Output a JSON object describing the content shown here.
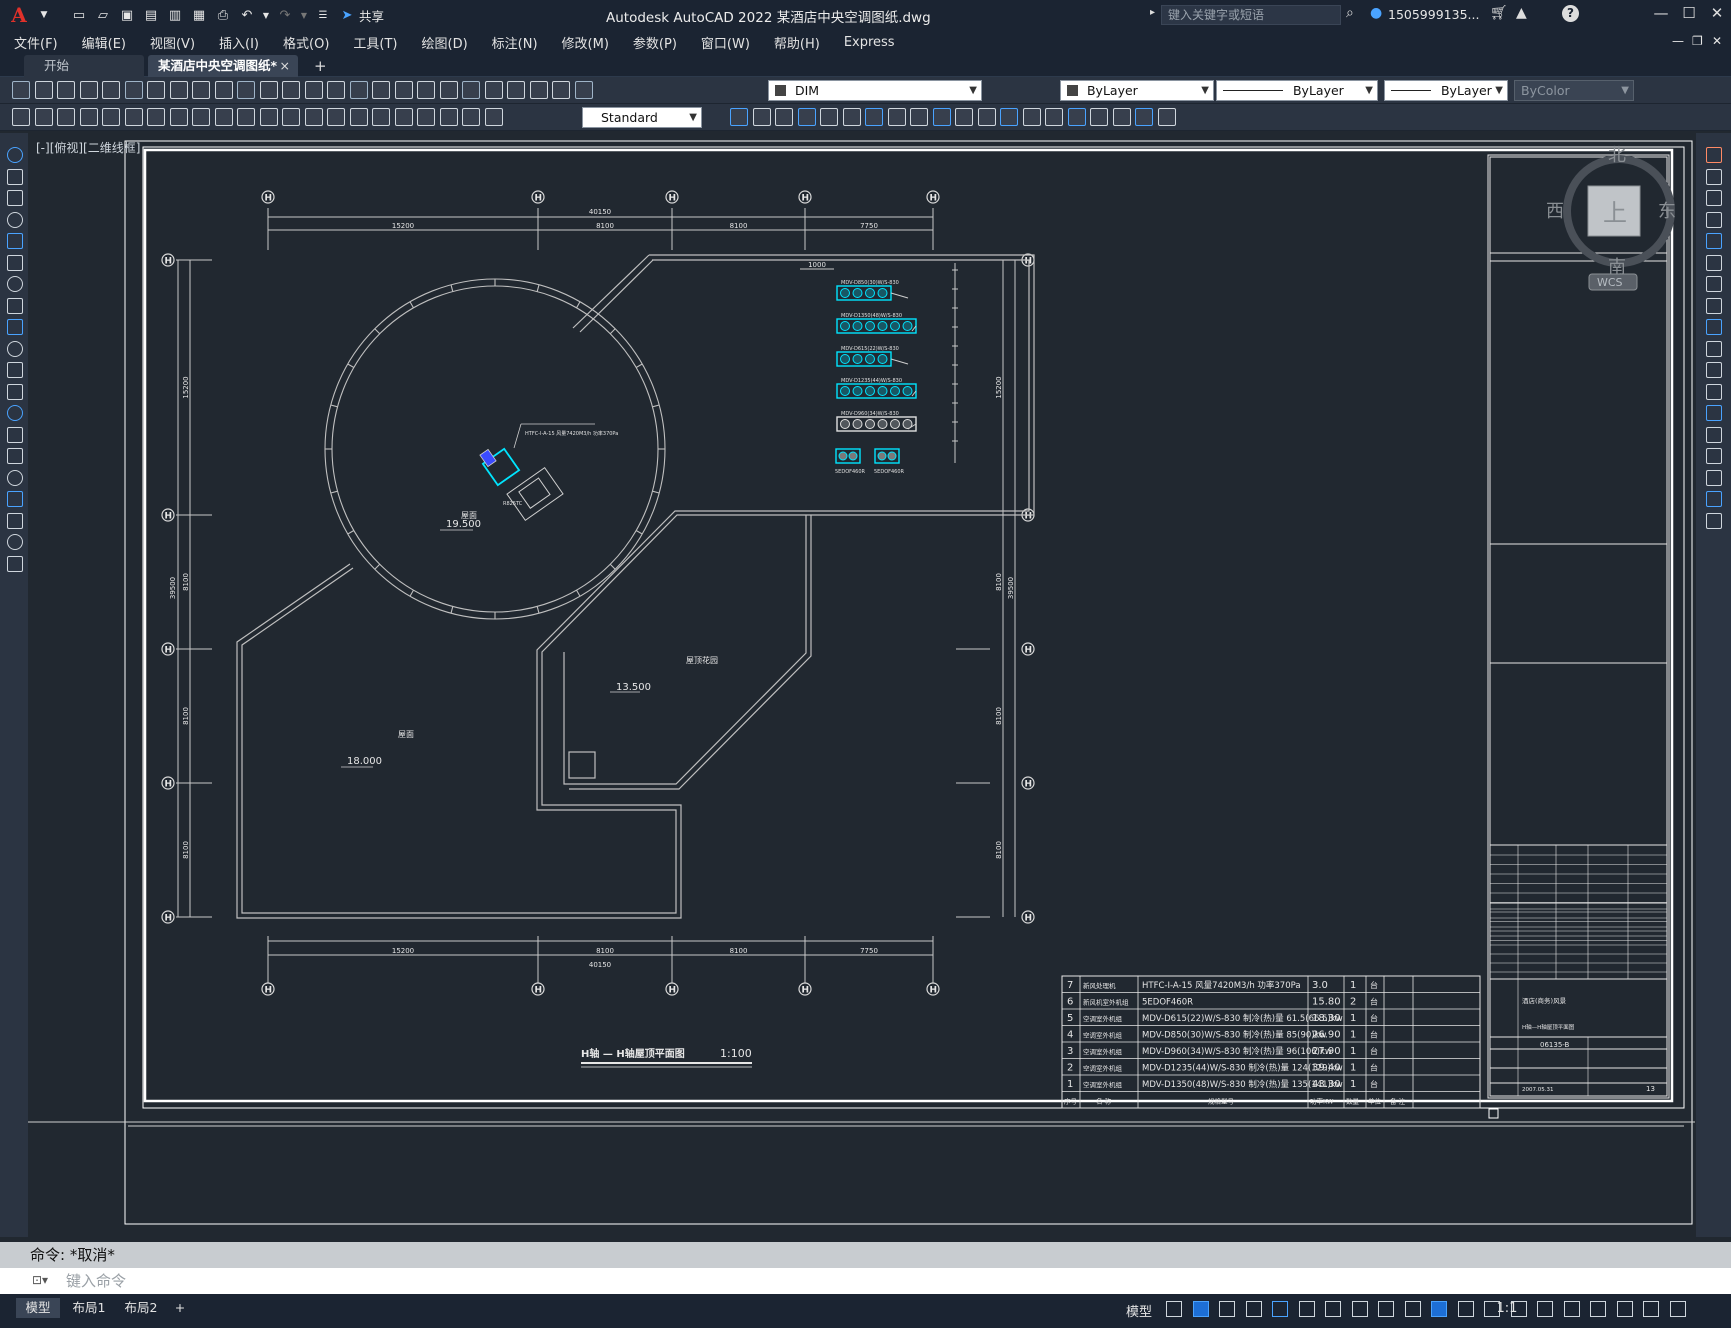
{
  "titlebar": {
    "app_icon": "A",
    "share_label": "共享",
    "title": "Autodesk AutoCAD 2022    某酒店中央空调图纸.dwg",
    "search_placeholder": "键入关键字或短语",
    "user": "1505999135...",
    "help_icon": "?"
  },
  "menu": [
    "文件(F)",
    "编辑(E)",
    "视图(V)",
    "插入(I)",
    "格式(O)",
    "工具(T)",
    "绘图(D)",
    "标注(N)",
    "修改(M)",
    "参数(P)",
    "窗口(W)",
    "帮助(H)",
    "Express"
  ],
  "tabs": {
    "start": "开始",
    "active": "某酒店中央空调图纸*",
    "close_icon": "×",
    "add_icon": "+"
  },
  "toolbar": {
    "layer": "DIM",
    "color": "ByLayer",
    "linetype": "ByLayer",
    "lineweight": "ByLayer",
    "plotstyle": "ByColor",
    "textstyle": "Standard"
  },
  "viewport_label": "[-][俯视][二维线框]",
  "viewcube": {
    "north": "北",
    "south": "南",
    "east": "东",
    "west": "西",
    "top": "上",
    "wcs": "WCS"
  },
  "drawing": {
    "axis_label": "H",
    "top_dims": [
      "15200",
      "8100",
      "8100",
      "7750"
    ],
    "top_total": "40150",
    "bottom_dims": [
      "15200",
      "8100",
      "8100",
      "7750"
    ],
    "bottom_total": "40150",
    "left_dims": [
      "15200",
      "8100",
      "8100",
      "8100"
    ],
    "left_total": "39500",
    "right_dims": [
      "15200",
      "8100",
      "8100",
      "8100"
    ],
    "right_total": "39500",
    "level_1": "19.500",
    "level_2": "13.500",
    "level_3": "18.000",
    "roof_label_1": "屋面",
    "roof_label_2": "屋顶花园",
    "roof_label_3": "屋面",
    "unit_label_top": "HTFC-I-A-15   风量7420M3/h 功率370Pa",
    "plan_title": "H轴 — H轴屋顶平面图",
    "scale": "1:100",
    "dim_1000": "1000",
    "equip_labels": [
      "MDV-D850(30)W/S-830",
      "MDV-D1350(48)W/S-830",
      "MDV-D615(22)W/S-830",
      "MDV-D1235(44)W/S-830",
      "MDV-D960(34)W/S-830"
    ],
    "equip_bottom": [
      "5EDOF460R",
      "5EDOF460R"
    ],
    "r_label": "R825TC"
  },
  "table": {
    "rows": [
      {
        "no": "7",
        "name": "新风处理机",
        "model": "HTFC-I-A-15  风量7420M3/h 功率370Pa",
        "kw": "3.0",
        "qty": "1",
        "unit": "台"
      },
      {
        "no": "6",
        "name": "新风机室外机组",
        "model": "5EDOF460R",
        "kw": "15.80",
        "qty": "2",
        "unit": "台"
      },
      {
        "no": "5",
        "name": "空调室外机组",
        "model": "MDV-D615(22)W/S-830      制冷(热)量 61.5(66.5)kw",
        "kw": "18.30",
        "qty": "1",
        "unit": "台"
      },
      {
        "no": "4",
        "name": "空调室外机组",
        "model": "MDV-D850(30)W/S-830      制冷(热)量 85(90)kw",
        "kw": "26.90",
        "qty": "1",
        "unit": "台"
      },
      {
        "no": "3",
        "name": "空调室外机组",
        "model": "MDV-D960(34)W/S-830      制冷(热)量 96(106)kw",
        "kw": "27.90",
        "qty": "1",
        "unit": "台"
      },
      {
        "no": "2",
        "name": "空调室外机组",
        "model": "MDV-D1235(44)W/S-830     制冷(热)量 124(129)kw",
        "kw": "39.40",
        "qty": "1",
        "unit": "台"
      },
      {
        "no": "1",
        "name": "空调室外机组",
        "model": "MDV-D1350(48)W/S-830     制冷(热)量 135(141)kw",
        "kw": "43.30",
        "qty": "1",
        "unit": "台"
      }
    ],
    "header": {
      "no": "序号",
      "name": "名  称",
      "model": "规格型号",
      "kw": "功率KW",
      "qty": "数量",
      "unit": "单位",
      "note": "备  注"
    }
  },
  "titleblock": {
    "drawing_no": "06135-B",
    "date": "2007.05.31",
    "sheet": "13",
    "project": "酒店(商务)风景",
    "drawing_name": "H轴—H轴屋顶平面图"
  },
  "command": {
    "history": "命令: *取消*",
    "prompt": "键入命令"
  },
  "status": {
    "tab_model": "模型",
    "tab_layout1": "布局1",
    "tab_layout2": "布局2",
    "add": "+",
    "model_btn": "模型",
    "scale": "1:1"
  },
  "colors": {
    "cyan": "#00e5ff",
    "line": "#c8c8c8",
    "dim": "#d9d9d9",
    "accent_blue": "#1d6fd6"
  }
}
